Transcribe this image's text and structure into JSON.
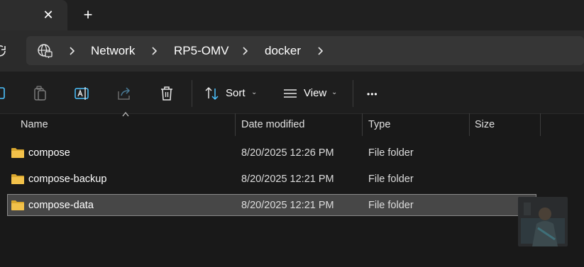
{
  "tabs": {
    "close_glyph": "✕",
    "new_tab_glyph": "+"
  },
  "breadcrumb": [
    "Network",
    "RP5-OMV",
    "docker"
  ],
  "toolbar": {
    "sort_label": "Sort",
    "view_label": "View",
    "more_glyph": "•••",
    "caret_glyph": "⌄"
  },
  "columns": {
    "name": "Name",
    "date_modified": "Date modified",
    "type": "Type",
    "size": "Size"
  },
  "files": [
    {
      "name": "compose",
      "date": "8/20/2025 12:26 PM",
      "type": "File folder",
      "size": ""
    },
    {
      "name": "compose-backup",
      "date": "8/20/2025 12:21 PM",
      "type": "File folder",
      "size": ""
    },
    {
      "name": "compose-data",
      "date": "8/20/2025 12:21 PM",
      "type": "File folder",
      "size": ""
    }
  ],
  "selected_row": 2,
  "colors": {
    "accent": "#4cc2ff",
    "folder": "#f2c14a",
    "selection": "#474747"
  }
}
